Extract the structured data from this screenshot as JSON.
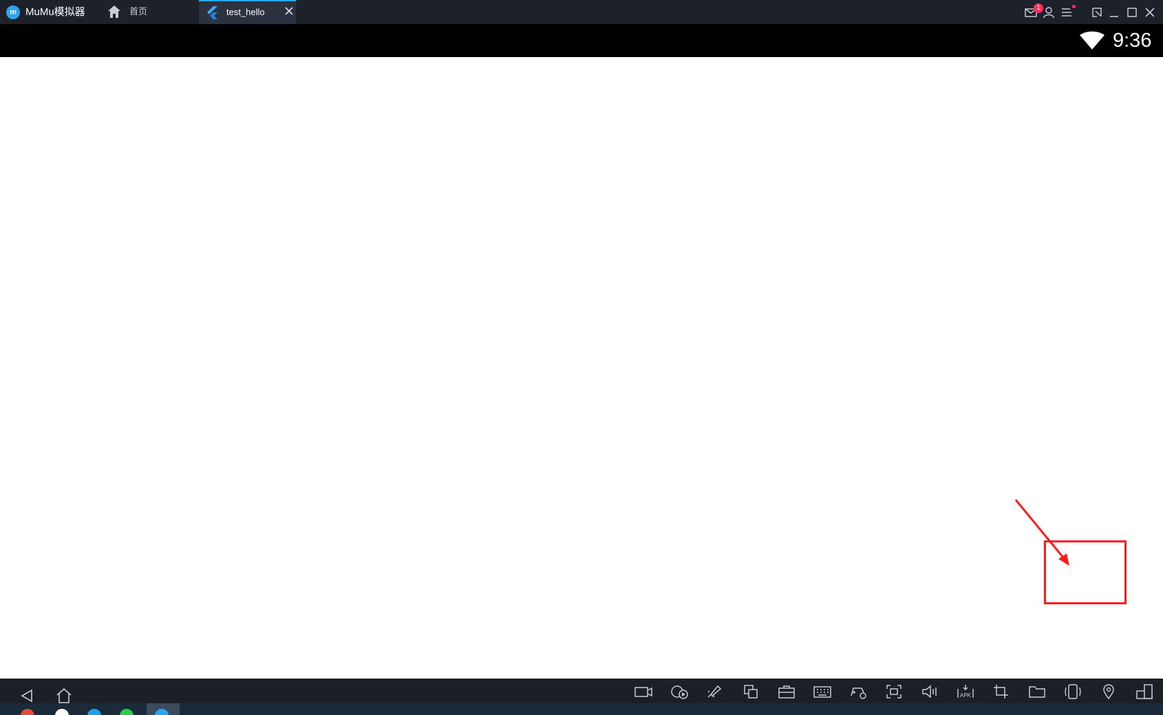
{
  "titlebar": {
    "app_name": "MuMu模拟器",
    "logo_text": "m",
    "home_tab_label": "首页",
    "active_tab_label": "test_hello",
    "mail_badge": "1",
    "icons": [
      "mail-icon",
      "user-icon",
      "menu-icon",
      "restore-icon",
      "minimize-icon",
      "maximize-icon",
      "close-icon"
    ]
  },
  "statusbar": {
    "time": "9:36",
    "icons": [
      "wifi-icon"
    ]
  },
  "toolbar": {
    "nav": [
      "back-icon",
      "home-icon"
    ],
    "icons": [
      "video-record-icon",
      "macro-icon",
      "rocket-icon",
      "multi-instance-icon",
      "toolbox-icon",
      "keyboard-icon",
      "gamepad-icon",
      "screenshot-icon",
      "volume-icon",
      "apk-install-icon",
      "crop-icon",
      "folder-icon",
      "shake-icon",
      "location-icon",
      "rotate-icon"
    ]
  },
  "colors": {
    "titlebar_bg": "#1d2129",
    "accent": "#2aa6f0",
    "annotation": "#ff1b1b",
    "badge": "#ff2e5a"
  }
}
